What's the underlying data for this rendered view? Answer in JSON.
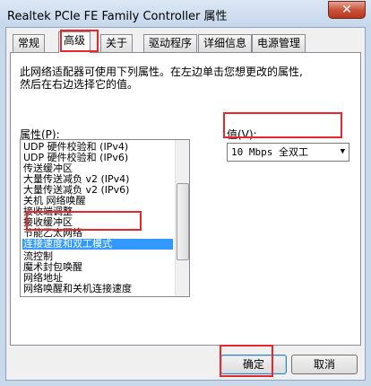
{
  "window": {
    "title": "Realtek PCIe FE Family Controller 属性",
    "close_label": "✕"
  },
  "tabs": [
    {
      "label": "常规"
    },
    {
      "label": "高级"
    },
    {
      "label": "关于"
    },
    {
      "label": "驱动程序"
    },
    {
      "label": "详细信息"
    },
    {
      "label": "电源管理"
    }
  ],
  "advanced": {
    "description_line1": "此网络适配器可使用下列属性。在左边单击您想更改的属性,",
    "description_line2": "然后在右边选择它的值。",
    "property_label": "属性(P):",
    "value_label": "值(V):",
    "properties": [
      "UDP 硬件校验和 (IPv4)",
      "UDP 硬件校验和 (IPv6)",
      "传送缓冲区",
      "大量传送减负 v2 (IPv4)",
      "大量传送减负 v2 (IPv6)",
      "关机 网络唤醒",
      "接收端调整",
      "接收缓冲区",
      "节能乙太网络",
      "连接速度和双工模式",
      "流控制",
      "魔术封包唤醒",
      "网络地址",
      "网络唤醒和关机连接速度"
    ],
    "selected_value": "10 Mbps 全双工",
    "dropdown_arrow": "▼"
  },
  "footer": {
    "ok_label": "确定",
    "cancel_label": "取消"
  }
}
